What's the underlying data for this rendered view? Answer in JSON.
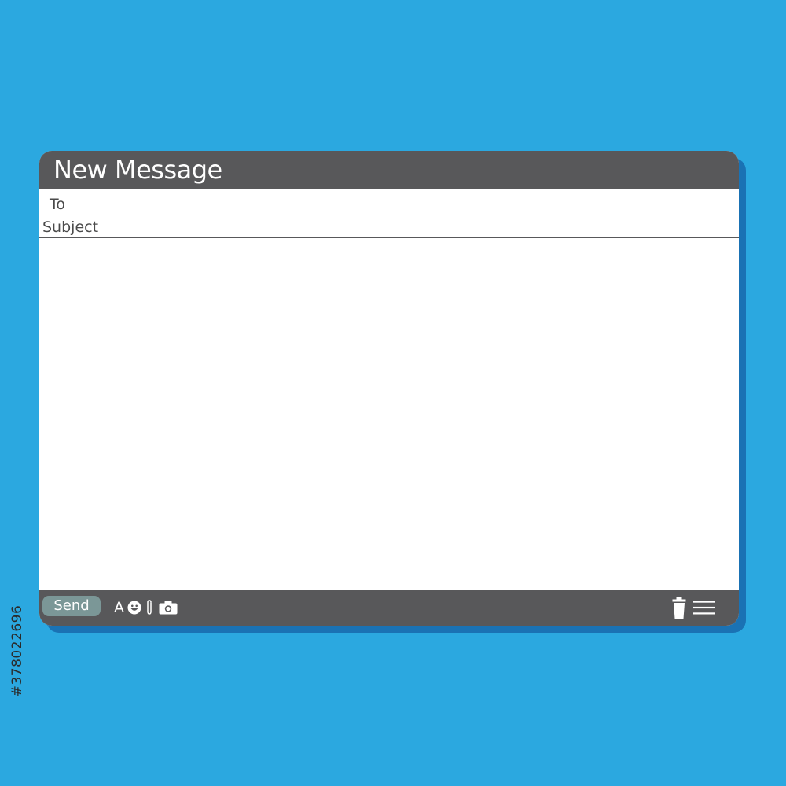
{
  "window": {
    "title": "New Message"
  },
  "fields": {
    "to": {
      "label": "To",
      "value": ""
    },
    "subject": {
      "label": "Subject",
      "value": ""
    }
  },
  "body": {
    "value": ""
  },
  "toolbar": {
    "send_label": "Send",
    "font_label": "A",
    "icons": [
      "emoji-icon",
      "paperclip-icon",
      "camera-icon",
      "trash-icon",
      "menu-icon"
    ]
  },
  "watermark": {
    "id_text": "#378022696"
  },
  "colors": {
    "background": "#2ba8e0",
    "shadow": "#1a72b4",
    "bar": "#58585a",
    "send_button": "#7b9797",
    "panel": "#ffffff"
  }
}
